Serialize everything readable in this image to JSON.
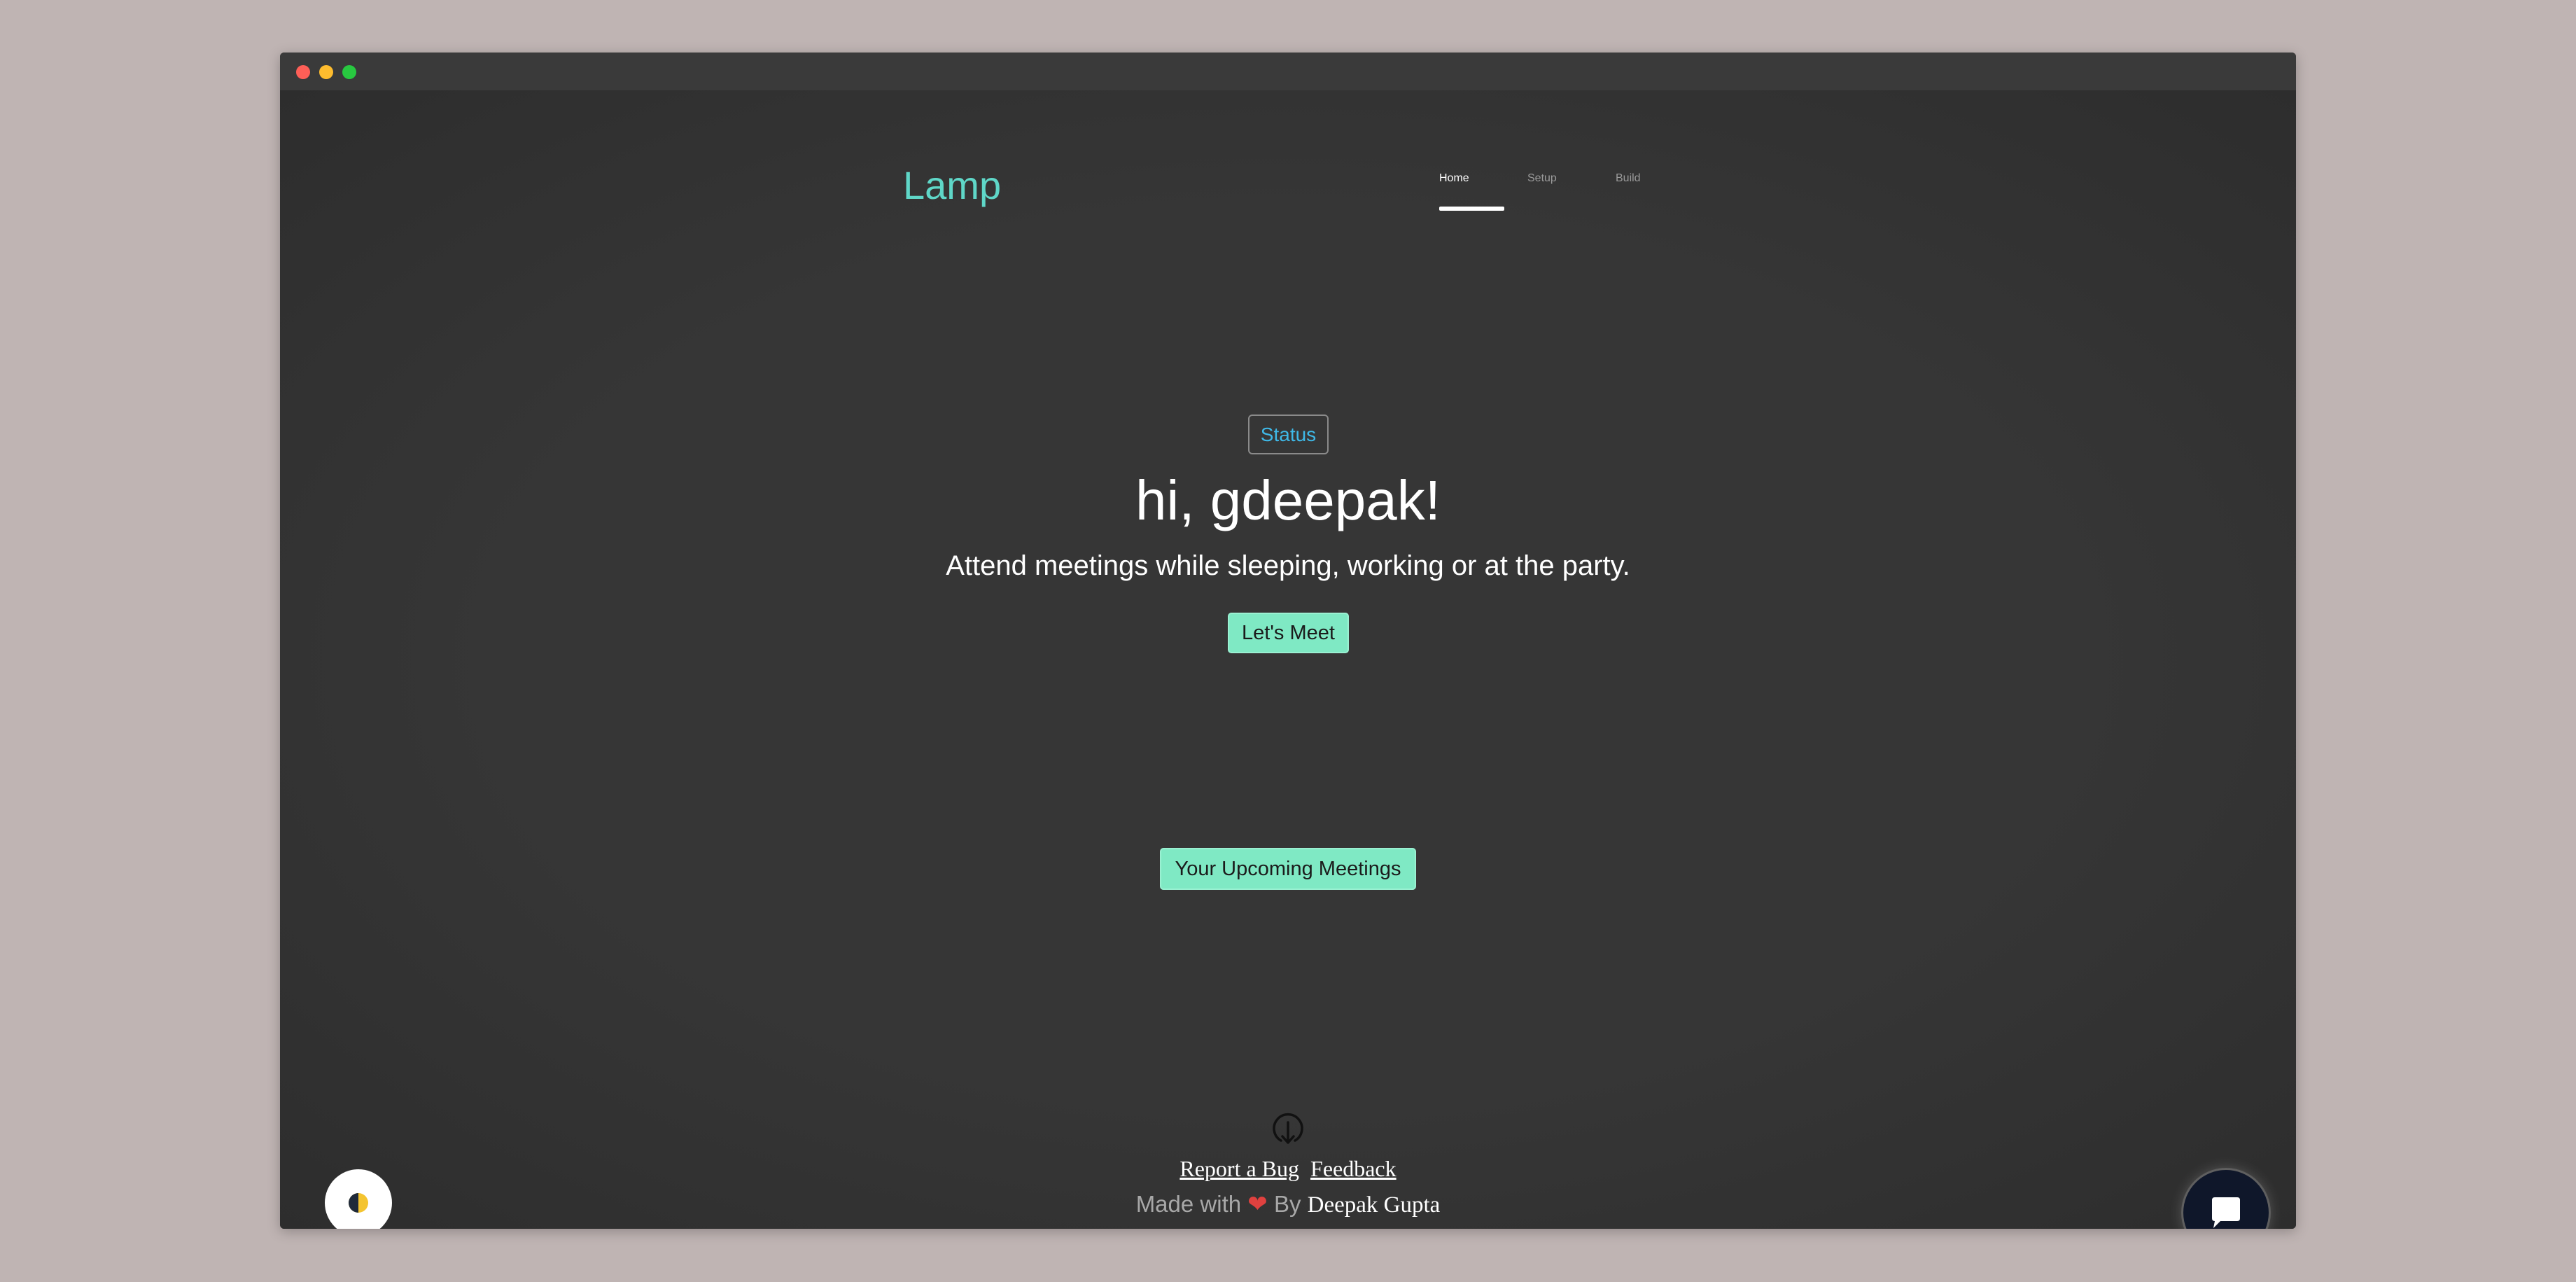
{
  "header": {
    "brand": "Lamp",
    "nav": [
      {
        "label": "Home",
        "active": true
      },
      {
        "label": "Setup",
        "active": false
      },
      {
        "label": "Build",
        "active": false
      }
    ]
  },
  "hero": {
    "status_label": "Status",
    "greeting": "hi, gdeepak!",
    "tagline": "Attend meetings while sleeping, working or at the party.",
    "meet_button": "Let's Meet",
    "upcoming_button": "Your Upcoming Meetings"
  },
  "footer": {
    "report_bug": "Report a Bug",
    "feedback": "Feedback",
    "made_with": "Made with",
    "by": "By",
    "author": "Deepak Gupta"
  },
  "widgets": {
    "theme_toggle_icon": "half-circle-icon",
    "chat_icon": "chat-bubble-icon",
    "download_icon": "download-icon"
  },
  "colors": {
    "brand": "#5fd7c8",
    "accent_button": "#7fe9c4",
    "status_text": "#3fb9e8",
    "heart": "#e0413f",
    "page_bg": "#323232"
  }
}
